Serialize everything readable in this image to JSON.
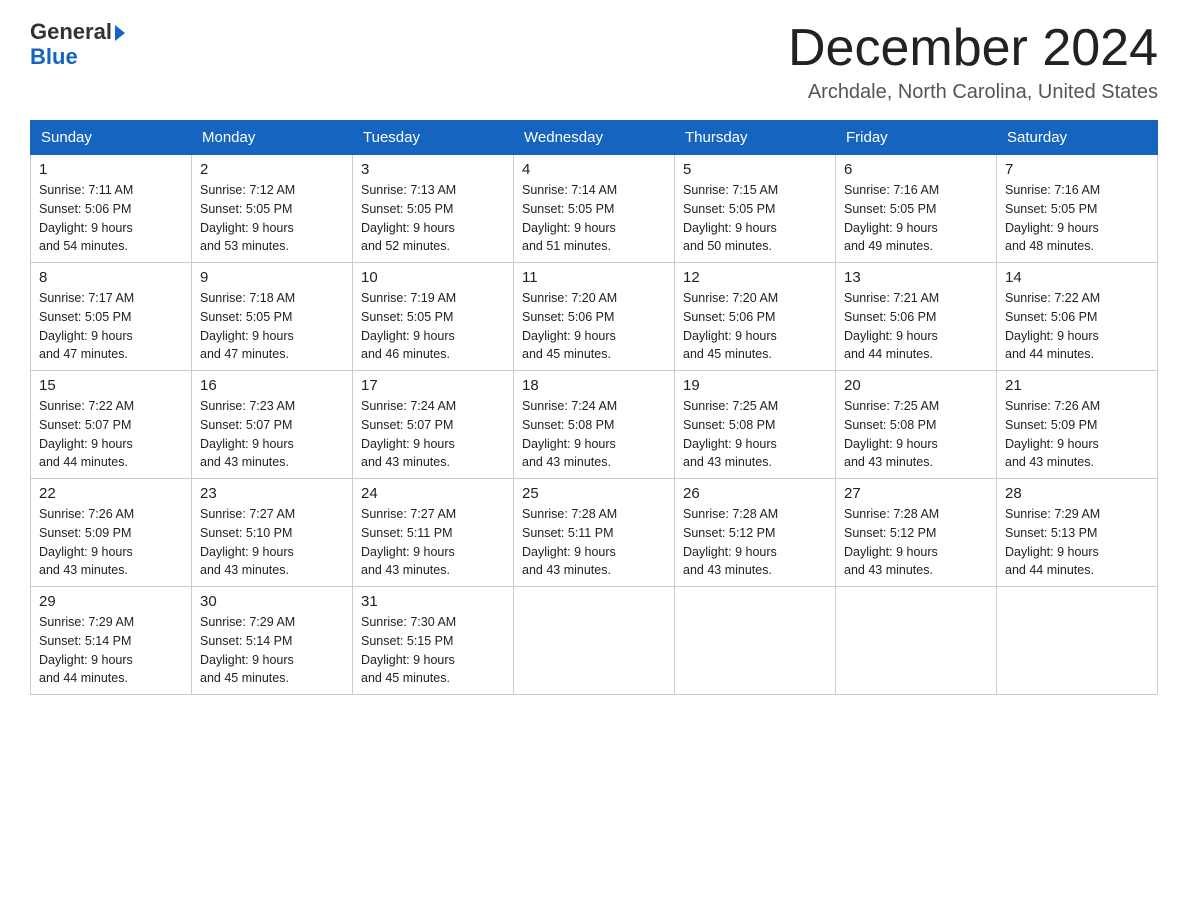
{
  "logo": {
    "general": "General",
    "blue": "Blue"
  },
  "title": "December 2024",
  "location": "Archdale, North Carolina, United States",
  "days_of_week": [
    "Sunday",
    "Monday",
    "Tuesday",
    "Wednesday",
    "Thursday",
    "Friday",
    "Saturday"
  ],
  "weeks": [
    [
      {
        "day": "1",
        "sunrise": "7:11 AM",
        "sunset": "5:06 PM",
        "daylight": "9 hours and 54 minutes."
      },
      {
        "day": "2",
        "sunrise": "7:12 AM",
        "sunset": "5:05 PM",
        "daylight": "9 hours and 53 minutes."
      },
      {
        "day": "3",
        "sunrise": "7:13 AM",
        "sunset": "5:05 PM",
        "daylight": "9 hours and 52 minutes."
      },
      {
        "day": "4",
        "sunrise": "7:14 AM",
        "sunset": "5:05 PM",
        "daylight": "9 hours and 51 minutes."
      },
      {
        "day": "5",
        "sunrise": "7:15 AM",
        "sunset": "5:05 PM",
        "daylight": "9 hours and 50 minutes."
      },
      {
        "day": "6",
        "sunrise": "7:16 AM",
        "sunset": "5:05 PM",
        "daylight": "9 hours and 49 minutes."
      },
      {
        "day": "7",
        "sunrise": "7:16 AM",
        "sunset": "5:05 PM",
        "daylight": "9 hours and 48 minutes."
      }
    ],
    [
      {
        "day": "8",
        "sunrise": "7:17 AM",
        "sunset": "5:05 PM",
        "daylight": "9 hours and 47 minutes."
      },
      {
        "day": "9",
        "sunrise": "7:18 AM",
        "sunset": "5:05 PM",
        "daylight": "9 hours and 47 minutes."
      },
      {
        "day": "10",
        "sunrise": "7:19 AM",
        "sunset": "5:05 PM",
        "daylight": "9 hours and 46 minutes."
      },
      {
        "day": "11",
        "sunrise": "7:20 AM",
        "sunset": "5:06 PM",
        "daylight": "9 hours and 45 minutes."
      },
      {
        "day": "12",
        "sunrise": "7:20 AM",
        "sunset": "5:06 PM",
        "daylight": "9 hours and 45 minutes."
      },
      {
        "day": "13",
        "sunrise": "7:21 AM",
        "sunset": "5:06 PM",
        "daylight": "9 hours and 44 minutes."
      },
      {
        "day": "14",
        "sunrise": "7:22 AM",
        "sunset": "5:06 PM",
        "daylight": "9 hours and 44 minutes."
      }
    ],
    [
      {
        "day": "15",
        "sunrise": "7:22 AM",
        "sunset": "5:07 PM",
        "daylight": "9 hours and 44 minutes."
      },
      {
        "day": "16",
        "sunrise": "7:23 AM",
        "sunset": "5:07 PM",
        "daylight": "9 hours and 43 minutes."
      },
      {
        "day": "17",
        "sunrise": "7:24 AM",
        "sunset": "5:07 PM",
        "daylight": "9 hours and 43 minutes."
      },
      {
        "day": "18",
        "sunrise": "7:24 AM",
        "sunset": "5:08 PM",
        "daylight": "9 hours and 43 minutes."
      },
      {
        "day": "19",
        "sunrise": "7:25 AM",
        "sunset": "5:08 PM",
        "daylight": "9 hours and 43 minutes."
      },
      {
        "day": "20",
        "sunrise": "7:25 AM",
        "sunset": "5:08 PM",
        "daylight": "9 hours and 43 minutes."
      },
      {
        "day": "21",
        "sunrise": "7:26 AM",
        "sunset": "5:09 PM",
        "daylight": "9 hours and 43 minutes."
      }
    ],
    [
      {
        "day": "22",
        "sunrise": "7:26 AM",
        "sunset": "5:09 PM",
        "daylight": "9 hours and 43 minutes."
      },
      {
        "day": "23",
        "sunrise": "7:27 AM",
        "sunset": "5:10 PM",
        "daylight": "9 hours and 43 minutes."
      },
      {
        "day": "24",
        "sunrise": "7:27 AM",
        "sunset": "5:11 PM",
        "daylight": "9 hours and 43 minutes."
      },
      {
        "day": "25",
        "sunrise": "7:28 AM",
        "sunset": "5:11 PM",
        "daylight": "9 hours and 43 minutes."
      },
      {
        "day": "26",
        "sunrise": "7:28 AM",
        "sunset": "5:12 PM",
        "daylight": "9 hours and 43 minutes."
      },
      {
        "day": "27",
        "sunrise": "7:28 AM",
        "sunset": "5:12 PM",
        "daylight": "9 hours and 43 minutes."
      },
      {
        "day": "28",
        "sunrise": "7:29 AM",
        "sunset": "5:13 PM",
        "daylight": "9 hours and 44 minutes."
      }
    ],
    [
      {
        "day": "29",
        "sunrise": "7:29 AM",
        "sunset": "5:14 PM",
        "daylight": "9 hours and 44 minutes."
      },
      {
        "day": "30",
        "sunrise": "7:29 AM",
        "sunset": "5:14 PM",
        "daylight": "9 hours and 45 minutes."
      },
      {
        "day": "31",
        "sunrise": "7:30 AM",
        "sunset": "5:15 PM",
        "daylight": "9 hours and 45 minutes."
      },
      null,
      null,
      null,
      null
    ]
  ]
}
